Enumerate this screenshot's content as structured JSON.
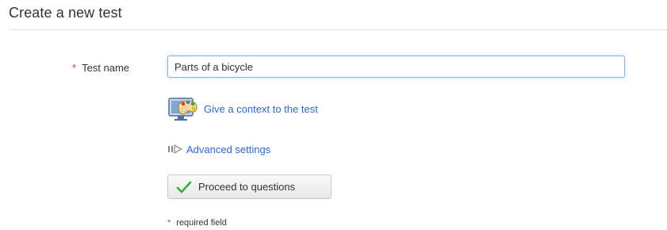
{
  "page": {
    "title": "Create a new test"
  },
  "form": {
    "required_marker": "*",
    "test_name_label": "Test name",
    "test_name_value": "Parts of a bicycle",
    "context_link": "Give a context to the test",
    "context_icon": "palette-monitor-icon",
    "advanced_link": "Advanced settings",
    "advanced_icon": "arrow-right-icon",
    "proceed_button": "Proceed to questions",
    "proceed_icon": "checkmark-icon",
    "required_note": "required field"
  },
  "colors": {
    "link": "#3366cc",
    "required": "#e03030",
    "check": "#3aa83a",
    "input_focus_border": "#8fb4dc"
  }
}
